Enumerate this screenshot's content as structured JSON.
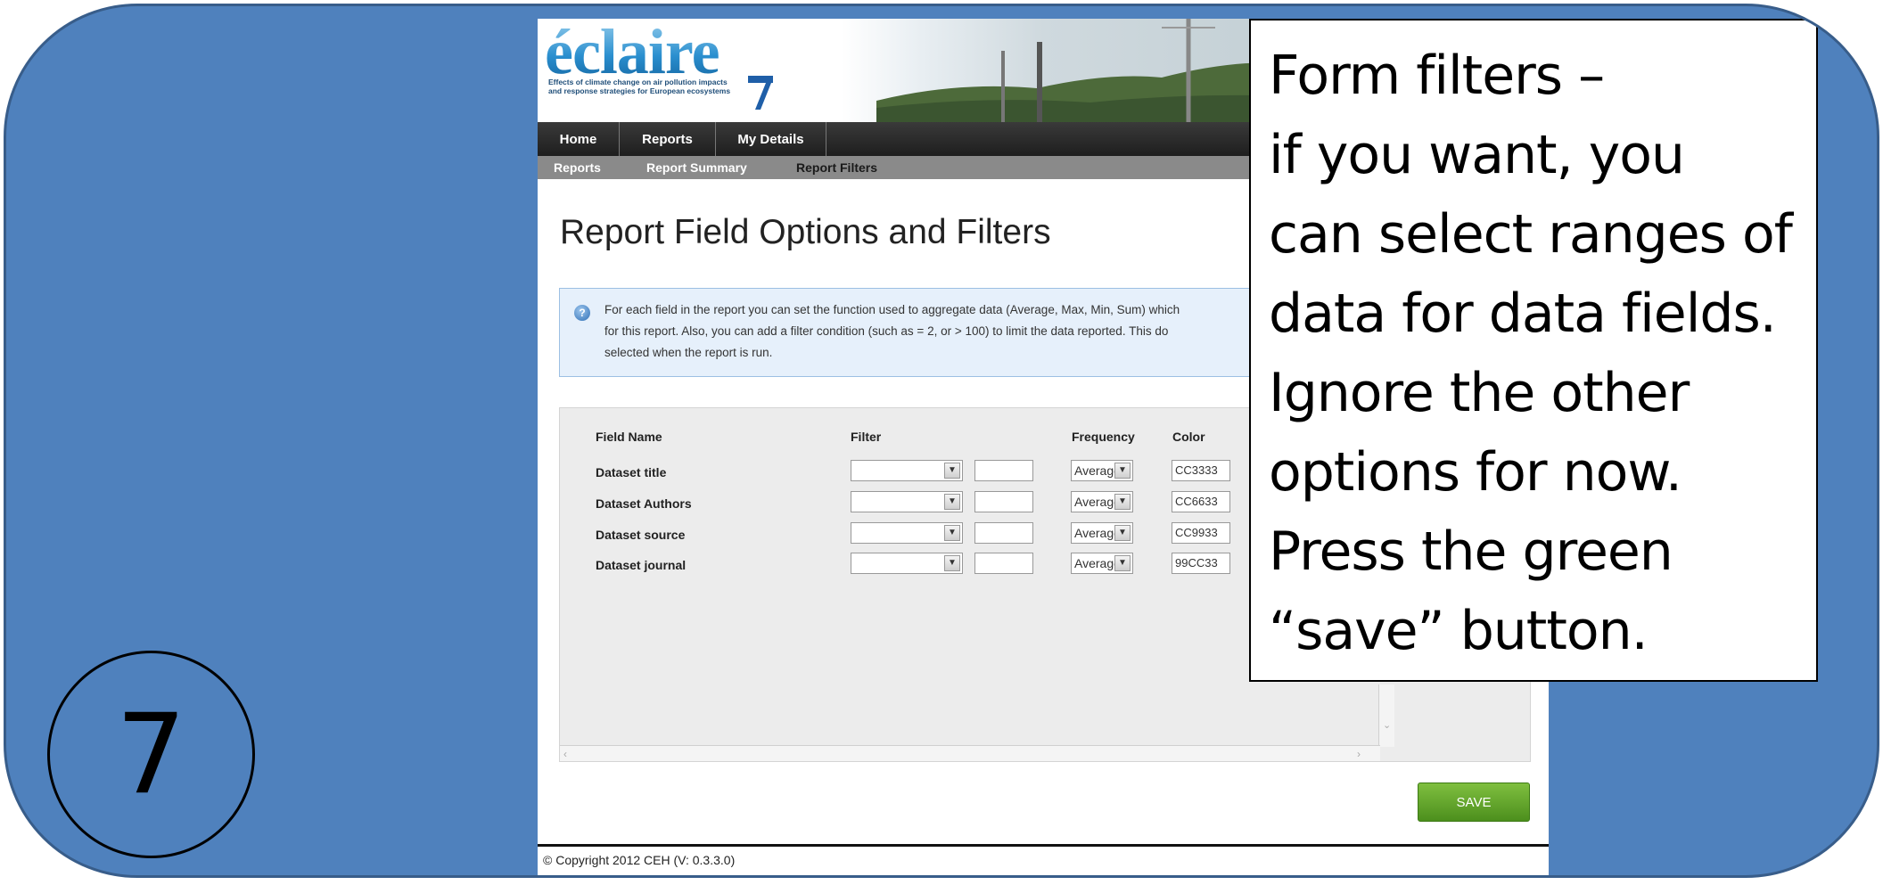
{
  "step_number": "7",
  "header": {
    "logo_text": "éclaire",
    "logo_tagline_1": "Effects of climate change on air pollution impacts",
    "logo_tagline_2": "and response strategies for European ecosystems"
  },
  "nav": {
    "tabs": [
      {
        "label": "Home"
      },
      {
        "label": "Reports"
      },
      {
        "label": "My Details"
      }
    ],
    "subnav": [
      {
        "label": "Reports"
      },
      {
        "label": "Report Summary"
      },
      {
        "label": "Report Filters"
      }
    ]
  },
  "page": {
    "title": "Report Field Options and Filters",
    "info_lines": [
      "For each field in the report you can set the function used to aggregate data (Average, Max, Min, Sum) which",
      "for this report. Also, you can add a filter condition (such as = 2, or > 100) to limit the data reported. This do",
      "selected when the report is run."
    ]
  },
  "table": {
    "headers": {
      "field_name": "Field Name",
      "filter": "Filter",
      "frequency": "Frequency",
      "color": "Color"
    },
    "rows": [
      {
        "field": "Dataset title",
        "frequency": "Average",
        "color": "CC3333"
      },
      {
        "field": "Dataset Authors",
        "frequency": "Average",
        "color": "CC6633"
      },
      {
        "field": "Dataset source",
        "frequency": "Average",
        "color": "CC9933"
      },
      {
        "field": "Dataset journal",
        "frequency": "Average",
        "color": "99CC33"
      }
    ]
  },
  "save_label": "SAVE",
  "footer": {
    "copyright": "© Copyright 2012 CEH  (V: 0.3.3.0)"
  },
  "callout": {
    "lines": [
      "Form filters –",
      "if you want, you",
      "can select ranges of",
      "data for data fields.",
      "Ignore the other",
      "options for now.",
      "Press the green",
      "“save” button."
    ]
  },
  "colors": {
    "slide_background": "#4f81bd",
    "save_button": "#5a9e2a",
    "nav_bar": "#2a2a2a",
    "subnav_bar": "#8a8a8a"
  },
  "icons": [
    "info-icon",
    "dropdown-arrow-icon",
    "scroll-left-icon",
    "scroll-right-icon",
    "scroll-down-icon"
  ]
}
